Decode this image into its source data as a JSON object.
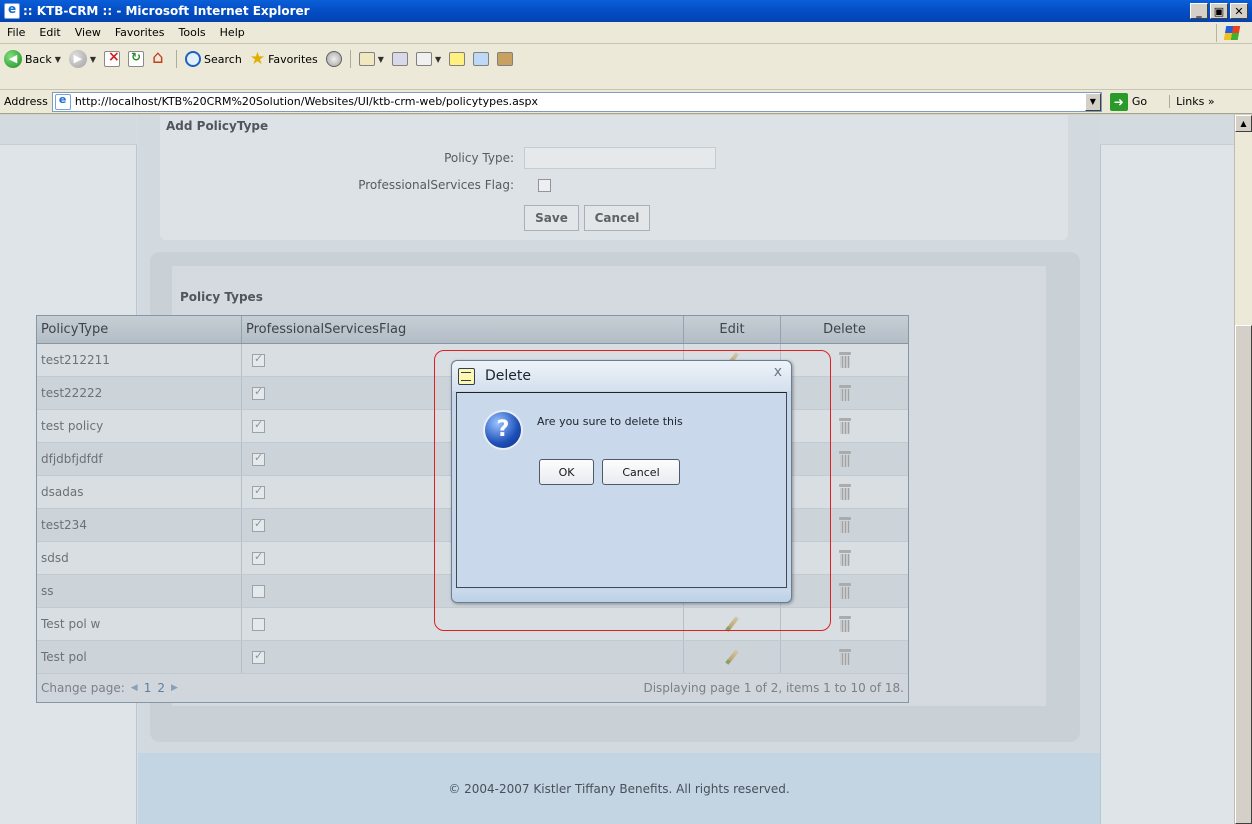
{
  "window": {
    "title": ":: KTB-CRM :: - Microsoft Internet Explorer",
    "minimize": "_",
    "maximize": "▣",
    "close": "✕"
  },
  "menu": {
    "items": [
      "File",
      "Edit",
      "View",
      "Favorites",
      "Tools",
      "Help"
    ]
  },
  "toolbar": {
    "back_label": "Back",
    "search_label": "Search",
    "favorites_label": "Favorites"
  },
  "address": {
    "label": "Address",
    "url": "http://localhost/KTB%20CRM%20Solution/Websites/UI/ktb-crm-web/policytypes.aspx",
    "go_label": "Go",
    "links_label": "Links"
  },
  "add_form": {
    "title": "Add PolicyType",
    "policy_type_label": "Policy Type:",
    "policy_type_value": "",
    "ps_flag_label": "ProfessionalServices Flag:",
    "ps_flag_checked": false,
    "save_label": "Save",
    "cancel_label": "Cancel"
  },
  "grid": {
    "title": "Policy Types",
    "columns": [
      "PolicyType",
      "ProfessionalServicesFlag",
      "Edit",
      "Delete"
    ],
    "rows": [
      {
        "name": "test212211",
        "flag": true
      },
      {
        "name": "test22222",
        "flag": true
      },
      {
        "name": "test policy",
        "flag": true
      },
      {
        "name": "dfjdbfjdfdf",
        "flag": true
      },
      {
        "name": "dsadas",
        "flag": true
      },
      {
        "name": "test234",
        "flag": true
      },
      {
        "name": "sdsd",
        "flag": true
      },
      {
        "name": "ss",
        "flag": false
      },
      {
        "name": "Test pol w",
        "flag": false
      },
      {
        "name": "Test pol",
        "flag": true
      }
    ],
    "pager": {
      "label": "Change page:",
      "pages": [
        "1",
        "2"
      ],
      "summary": "Displaying page 1 of 2, items 1 to 10 of 18."
    }
  },
  "footer": {
    "text": "© 2004-2007 Kistler Tiffany Benefits. All rights reserved."
  },
  "dialog": {
    "title": "Delete",
    "close": "x",
    "message": "Are you sure to delete this",
    "ok_label": "OK",
    "cancel_label": "Cancel"
  }
}
